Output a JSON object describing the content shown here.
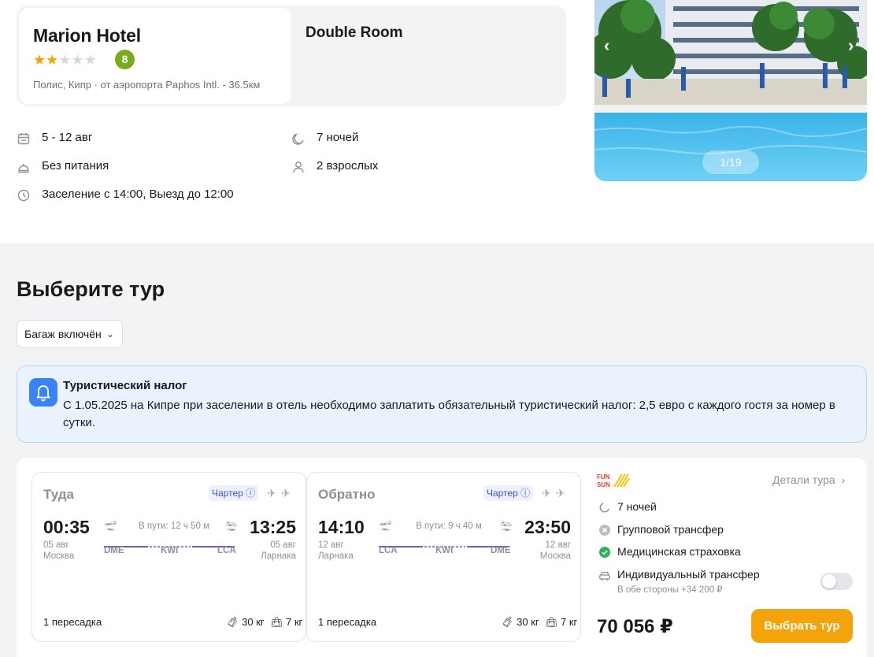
{
  "hotel": {
    "name": "Marion Hotel",
    "stars_filled": 2,
    "stars_total": 5,
    "rating": "8",
    "location": "Полис, Кипр · от аэропорта Paphos Intl. - 36.5км",
    "room": "Double Room"
  },
  "stay": {
    "dates": "5 - 12 авг",
    "nights": "7 ночей",
    "meals": "Без питания",
    "guests": "2 взрослых",
    "checkin": "Заселение с 14:00, Выезд до 12:00"
  },
  "gallery": {
    "counter": "1/19",
    "prev": "‹",
    "next": "›"
  },
  "tours": {
    "title": "Выберите тур",
    "filter_label": "Багаж включён"
  },
  "notice": {
    "title": "Туристический налог",
    "text": "С 1.05.2025 на Кипре при заселении в отель необходимо заплатить обязательный туристический налог: 2,5 евро с каждого гостя за номер в сутки."
  },
  "flights": [
    {
      "direction": "Туда",
      "type": "Чартер",
      "dep_time": "00:35",
      "dep_date": "05 авг",
      "dep_city": "Москва",
      "arr_time": "13:25",
      "arr_date": "05 авг",
      "arr_city": "Ларнака",
      "duration": "В пути: 12 ч 50 м",
      "airports": [
        "DME",
        "KWI",
        "LCA"
      ],
      "stops": "1 пересадка",
      "baggage": "30 кг",
      "hand_luggage": "7 кг"
    },
    {
      "direction": "Обратно",
      "type": "Чартер",
      "dep_time": "14:10",
      "dep_date": "12 авг",
      "dep_city": "Ларнака",
      "arr_time": "23:50",
      "arr_date": "12 авг",
      "arr_city": "Москва",
      "duration": "В пути: 9 ч 40 м",
      "airports": [
        "LCA",
        "KWI",
        "DME"
      ],
      "stops": "1 пересадка",
      "baggage": "30 кг",
      "hand_luggage": "7 кг"
    }
  ],
  "offer": {
    "details_link": "Детали тура",
    "nights": "7 ночей",
    "transfer_group": "Групповой трансфер",
    "insurance": "Медицинская страховка",
    "transfer_individual": "Индивидуальный трансфер",
    "transfer_individual_sub": "В обе стороны +34 200 ₽",
    "price": "70 056 ₽",
    "select_label": "Выбрать тур"
  },
  "colors": {
    "accent": "#f5a30a",
    "rating": "#7aaa1e",
    "route_line": "#5b5fe0",
    "notice_bg": "#e9f2fd"
  }
}
